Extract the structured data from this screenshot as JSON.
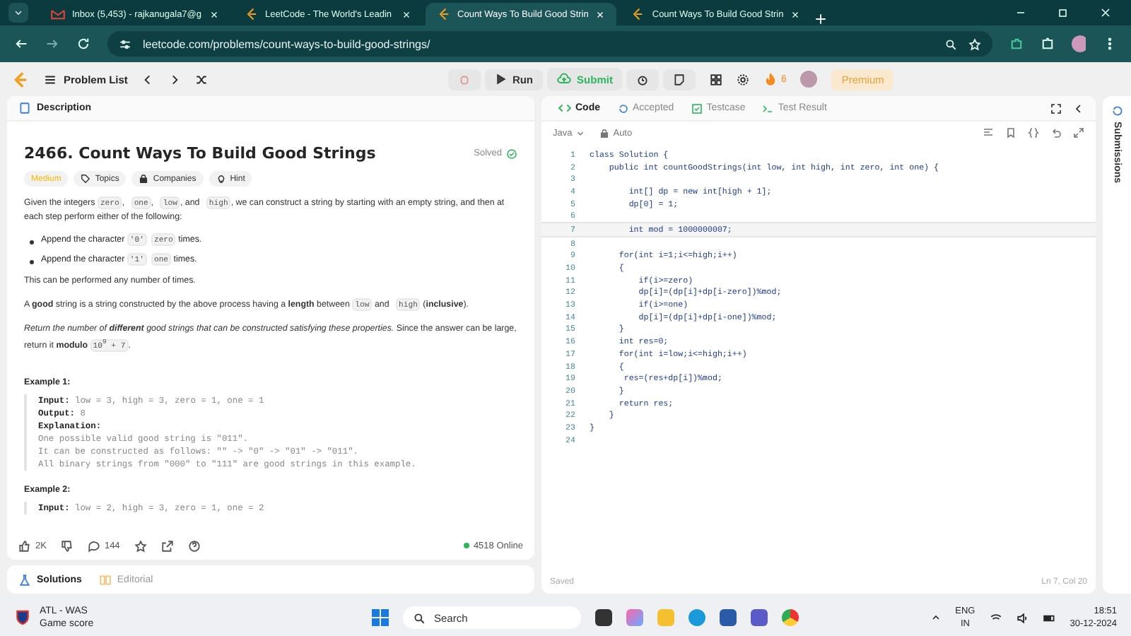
{
  "browser": {
    "tabs": [
      {
        "title": "Inbox (5,453) - rajkanugala7@g",
        "kind": "mail",
        "selected": false
      },
      {
        "title": "LeetCode - The World's Leadin",
        "kind": "leetcode",
        "selected": false
      },
      {
        "title": "Count Ways To Build Good Strin",
        "kind": "leetcode",
        "selected": true
      },
      {
        "title": "Count Ways To Build Good Strin",
        "kind": "leetcode",
        "selected": false
      }
    ],
    "url": "leetcode.com/problems/count-ways-to-build-good-strings/"
  },
  "toolbar": {
    "problem_list": "Problem List",
    "run": "Run",
    "submit": "Submit",
    "streak": "6",
    "premium": "Premium"
  },
  "description": {
    "tab": "Description",
    "title": "2466. Count Ways To Build Good Strings",
    "status": "Solved",
    "difficulty": "Medium",
    "tags": [
      "Topics",
      "Companies",
      "Hint"
    ],
    "blocks": [
      {
        "kind": "para",
        "parts": [
          {
            "kind": "text",
            "text": "Given the integers "
          },
          {
            "kind": "code",
            "text": "zero"
          },
          {
            "kind": "text",
            "text": ", "
          },
          {
            "kind": "code",
            "text": "one"
          },
          {
            "kind": "text",
            "text": ", "
          },
          {
            "kind": "code",
            "text": "low"
          },
          {
            "kind": "text",
            "text": ", and "
          },
          {
            "kind": "code",
            "text": "high"
          },
          {
            "kind": "text",
            "text": ", we can construct a string by starting with an empty string, and then at each step perform either of the following:"
          }
        ]
      },
      {
        "kind": "bullet",
        "parts": [
          {
            "kind": "text",
            "text": "Append the character "
          },
          {
            "kind": "code",
            "text": "'0'"
          },
          {
            "kind": "code",
            "text": "zero"
          },
          {
            "kind": "text",
            "text": " times."
          }
        ]
      },
      {
        "kind": "bullet",
        "parts": [
          {
            "kind": "text",
            "text": "Append the character "
          },
          {
            "kind": "code",
            "text": "'1'"
          },
          {
            "kind": "code",
            "text": "one"
          },
          {
            "kind": "text",
            "text": " times."
          }
        ]
      },
      {
        "kind": "para",
        "parts": [
          {
            "kind": "text",
            "text": "This can be performed any number of times."
          }
        ]
      },
      {
        "kind": "para",
        "parts": [
          {
            "kind": "text",
            "text": "A **good** string is a string constructed by the above process having a **length** between "
          },
          {
            "kind": "code",
            "text": "low"
          },
          {
            "kind": "text",
            "text": " and "
          },
          {
            "kind": "code",
            "text": "high"
          },
          {
            "kind": "text",
            "text": " (**inclusive**)."
          }
        ]
      },
      {
        "kind": "para",
        "parts": [
          {
            "kind": "em",
            "text": "Return the number of **different** good strings that can be constructed satisfying these properties."
          },
          {
            "kind": "text",
            "text": " Since the answer can be large, return it **modulo** "
          },
          {
            "kind": "code",
            "text": "10$^{9}$ + 7"
          },
          {
            "kind": "text",
            "text": "."
          }
        ]
      }
    ],
    "examples": [
      {
        "heading": "Example 1:",
        "lines": [
          {
            "label": "Input:",
            "value": "low = 3, high = 3, zero = 1, one = 1"
          },
          {
            "label": "Output:",
            "value": "8"
          },
          {
            "label": "Explanation:"
          },
          {
            "value": "One possible valid good string is \"011\"."
          },
          {
            "value": "It can be constructed as follows: \"\" -> \"0\" -> \"01\" -> \"011\"."
          },
          {
            "value": "All binary strings from \"000\" to \"111\" are good strings in this example."
          }
        ]
      },
      {
        "heading": "Example 2:",
        "lines": [
          {
            "label": "Input:",
            "value": "low = 2, high = 3, zero = 1, one = 2"
          }
        ]
      }
    ],
    "likes": "2K",
    "comments": "144",
    "online": "4518 Online"
  },
  "bottom_tabs": [
    {
      "label": "Solutions",
      "selected": true
    },
    {
      "label": "Editorial",
      "selected": false
    }
  ],
  "editor": {
    "tabs": [
      {
        "label": "Code",
        "selected": true
      },
      {
        "label": "Accepted",
        "selected": false
      },
      {
        "label": "Testcase",
        "selected": false
      },
      {
        "label": "Test Result",
        "selected": false
      }
    ],
    "language": "Java",
    "mode": "Auto",
    "lines": [
      {
        "no": "1",
        "text": "class Solution {",
        "current": false
      },
      {
        "no": "2",
        "text": "    public int countGoodStrings(int low, int high, int zero, int one) {",
        "current": false
      },
      {
        "no": "3",
        "current": false
      },
      {
        "no": "4",
        "text": "        int[] dp = new int[high + 1];",
        "current": false
      },
      {
        "no": "5",
        "text": "        dp[0] = 1;",
        "current": false
      },
      {
        "no": "6",
        "current": false
      },
      {
        "no": "7",
        "text": "        int mod = 1000000007;",
        "current": true
      },
      {
        "no": "8",
        "current": false
      },
      {
        "no": "9",
        "text": "      for(int i=1;i<=high;i++)",
        "current": false
      },
      {
        "no": "10",
        "text": "      {",
        "current": false
      },
      {
        "no": "11",
        "text": "          if(i>=zero)",
        "current": false
      },
      {
        "no": "12",
        "text": "          dp[i]=(dp[i]+dp[i-zero])%mod;",
        "current": false
      },
      {
        "no": "13",
        "text": "          if(i>=one)",
        "current": false
      },
      {
        "no": "14",
        "text": "          dp[i]=(dp[i]+dp[i-one])%mod;",
        "current": false
      },
      {
        "no": "15",
        "text": "      }",
        "current": false
      },
      {
        "no": "16",
        "text": "      int res=0;",
        "current": false
      },
      {
        "no": "17",
        "text": "      for(int i=low;i<=high;i++)",
        "current": false
      },
      {
        "no": "18",
        "text": "      {",
        "current": false
      },
      {
        "no": "19",
        "text": "       res=(res+dp[i])%mod;",
        "current": false
      },
      {
        "no": "20",
        "text": "      }",
        "current": false
      },
      {
        "no": "21",
        "text": "      return res;",
        "current": false
      },
      {
        "no": "22",
        "text": "    }",
        "current": false
      },
      {
        "no": "23",
        "text": "}",
        "current": false
      },
      {
        "no": "24",
        "current": false
      }
    ],
    "status": "Saved",
    "cursor": "Ln 7, Col 20"
  },
  "side_panel": {
    "label": "Submissions"
  },
  "taskbar": {
    "weather_title": "ATL - WAS",
    "weather_sub": "Game score",
    "search": "Search",
    "lang": "ENG",
    "region": "IN",
    "time": "18:51",
    "date": "30-12-2024"
  }
}
